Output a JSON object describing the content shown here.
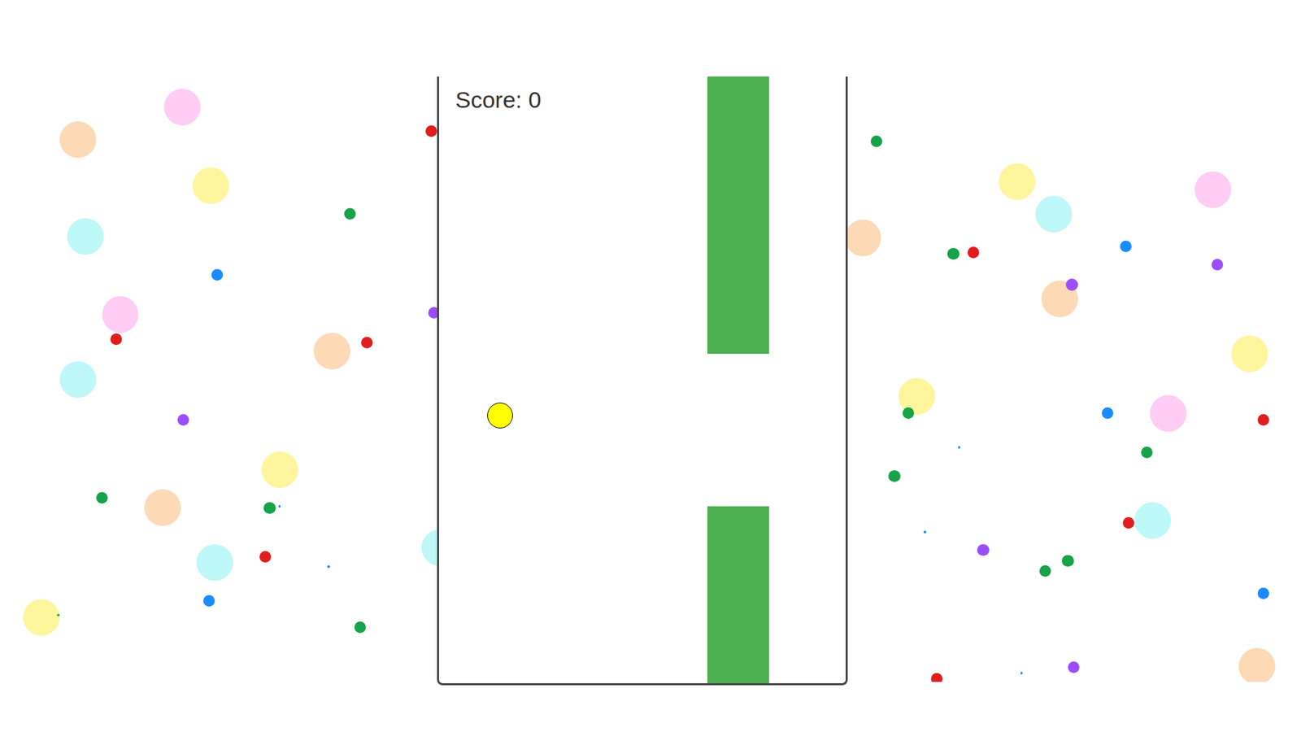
{
  "game": {
    "score": "Score: 0"
  }
}
